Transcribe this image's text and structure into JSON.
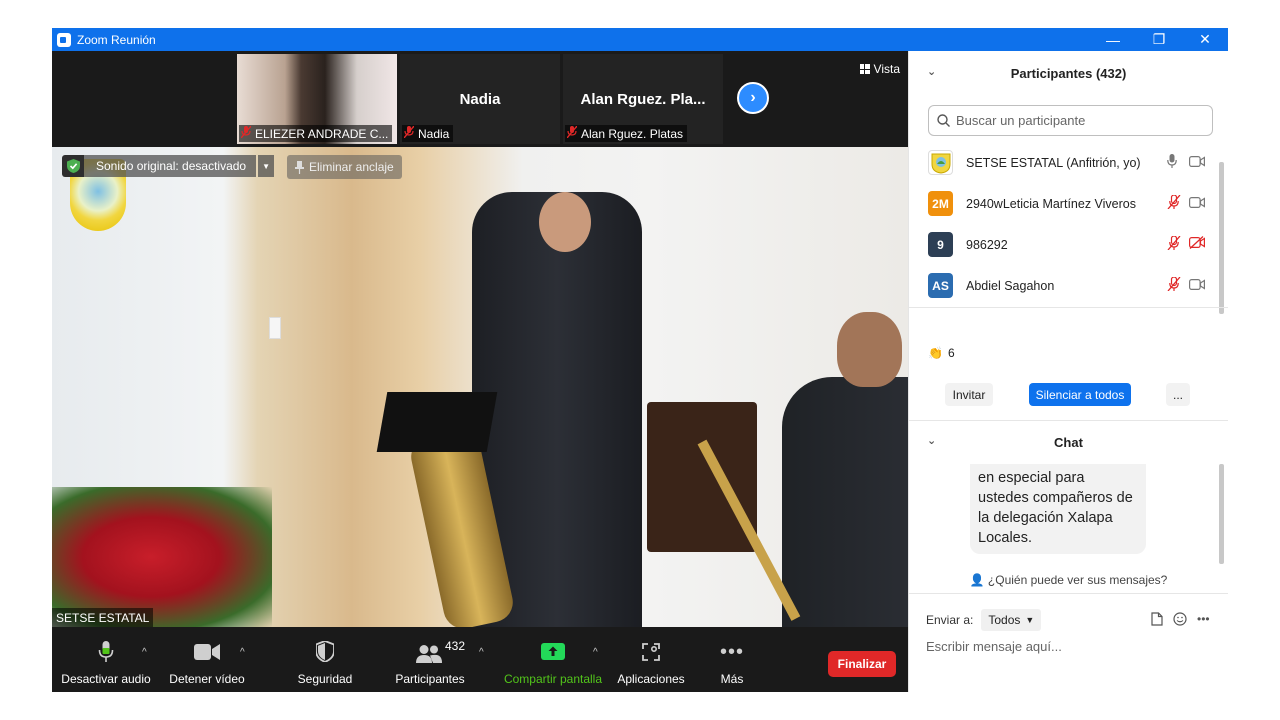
{
  "window": {
    "title": "Zoom Reunión",
    "minimize": "—",
    "restore": "❐",
    "close": "✕"
  },
  "thumbnails": [
    {
      "label": "ELIEZER ANDRADE C...",
      "name": ""
    },
    {
      "label": "Nadia",
      "name": "Nadia"
    },
    {
      "label": "Alan  Rguez. Platas",
      "name": "Alan  Rguez. Pla..."
    }
  ],
  "view_label": "Vista",
  "main_video": {
    "participant_label": "SETSE ESTATAL",
    "original_sound": "Sonido original: desactivado",
    "unpin": "Eliminar anclaje"
  },
  "toolbar": {
    "mute": "Desactivar audio",
    "stop_video": "Detener vídeo",
    "security": "Seguridad",
    "participants": "Participantes",
    "participants_count": "432",
    "share": "Compartir pantalla",
    "apps": "Aplicaciones",
    "more": "Más",
    "end": "Finalizar"
  },
  "participants_panel": {
    "title": "Participantes (432)",
    "search_placeholder": "Buscar un participante",
    "items": [
      {
        "initials": "",
        "name": "SETSE ESTATAL (Anfitrión, yo)",
        "avatar_color": "#ffffff",
        "muted": false,
        "video_off": false
      },
      {
        "initials": "2M",
        "name": "2940wLeticia Martínez Viveros",
        "avatar_color": "#f0900c",
        "muted": true,
        "video_off": false
      },
      {
        "initials": "9",
        "name": "986292",
        "avatar_color": "#2d3f55",
        "muted": true,
        "video_off": true
      },
      {
        "initials": "AS",
        "name": "Abdiel Sagahon",
        "avatar_color": "#2b6cb0",
        "muted": true,
        "video_off": false
      }
    ],
    "reaction_count": "6",
    "invite": "Invitar",
    "mute_all": "Silenciar a todos",
    "more": "..."
  },
  "chat_panel": {
    "title": "Chat",
    "message": "en especial para ustedes compañeros de la delegación Xalapa Locales.",
    "who_can_see": "¿Quién puede ver sus mensajes?",
    "send_to_label": "Enviar a:",
    "send_to_value": "Todos",
    "input_placeholder": "Escribir mensaje aquí..."
  },
  "colors": {
    "zoom_blue": "#0e71eb",
    "accent_blue": "#0e72ed",
    "end_red": "#e02828",
    "share_green": "#52c41a",
    "mute_red": "#e02828"
  }
}
